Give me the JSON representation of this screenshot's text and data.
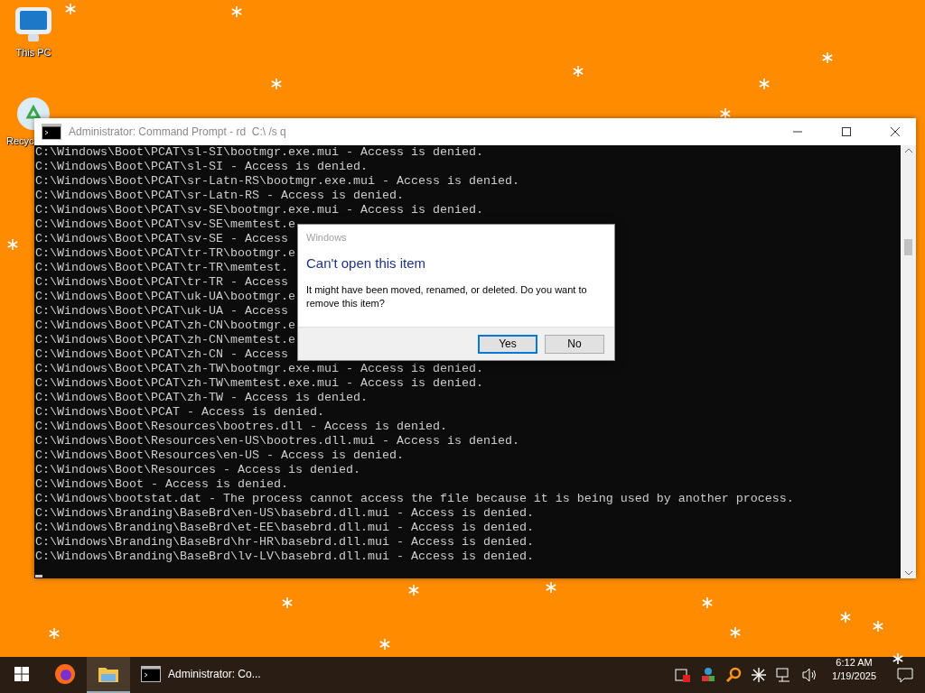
{
  "desktop": {
    "icons": [
      {
        "label": "This PC",
        "kind": "monitor"
      },
      {
        "label": "Recyc",
        "kind": "recycle"
      }
    ]
  },
  "console_window": {
    "title": "Administrator: Command Prompt - rd  C:\\ /s q",
    "lines": [
      "C:\\Windows\\Boot\\PCAT\\sl-SI\\bootmgr.exe.mui - Access is denied.",
      "C:\\Windows\\Boot\\PCAT\\sl-SI - Access is denied.",
      "C:\\Windows\\Boot\\PCAT\\sr-Latn-RS\\bootmgr.exe.mui - Access is denied.",
      "C:\\Windows\\Boot\\PCAT\\sr-Latn-RS - Access is denied.",
      "C:\\Windows\\Boot\\PCAT\\sv-SE\\bootmgr.exe.mui - Access is denied.",
      "C:\\Windows\\Boot\\PCAT\\sv-SE\\memtest.e",
      "C:\\Windows\\Boot\\PCAT\\sv-SE - Access",
      "C:\\Windows\\Boot\\PCAT\\tr-TR\\bootmgr.e",
      "C:\\Windows\\Boot\\PCAT\\tr-TR\\memtest.",
      "C:\\Windows\\Boot\\PCAT\\tr-TR - Access",
      "C:\\Windows\\Boot\\PCAT\\uk-UA\\bootmgr.e",
      "C:\\Windows\\Boot\\PCAT\\uk-UA - Access",
      "C:\\Windows\\Boot\\PCAT\\zh-CN\\bootmgr.e",
      "C:\\Windows\\Boot\\PCAT\\zh-CN\\memtest.e",
      "C:\\Windows\\Boot\\PCAT\\zh-CN - Access",
      "C:\\Windows\\Boot\\PCAT\\zh-TW\\bootmgr.exe.mui - Access is denied.",
      "C:\\Windows\\Boot\\PCAT\\zh-TW\\memtest.exe.mui - Access is denied.",
      "C:\\Windows\\Boot\\PCAT\\zh-TW - Access is denied.",
      "C:\\Windows\\Boot\\PCAT - Access is denied.",
      "C:\\Windows\\Boot\\Resources\\bootres.dll - Access is denied.",
      "C:\\Windows\\Boot\\Resources\\en-US\\bootres.dll.mui - Access is denied.",
      "C:\\Windows\\Boot\\Resources\\en-US - Access is denied.",
      "C:\\Windows\\Boot\\Resources - Access is denied.",
      "C:\\Windows\\Boot - Access is denied.",
      "C:\\Windows\\bootstat.dat - The process cannot access the file because it is being used by another process.",
      "C:\\Windows\\Branding\\BaseBrd\\en-US\\basebrd.dll.mui - Access is denied.",
      "C:\\Windows\\Branding\\BaseBrd\\et-EE\\basebrd.dll.mui - Access is denied.",
      "C:\\Windows\\Branding\\BaseBrd\\hr-HR\\basebrd.dll.mui - Access is denied.",
      "C:\\Windows\\Branding\\BaseBrd\\lv-LV\\basebrd.dll.mui - Access is denied."
    ]
  },
  "dialog": {
    "title": "Windows",
    "heading": "Can't open this item",
    "message": "It might have been moved, renamed, or deleted. Do you want to remove this item?",
    "buttons": [
      {
        "label": "Yes",
        "selected": true
      },
      {
        "label": "No",
        "selected": false
      }
    ]
  },
  "taskbar": {
    "items": [
      {
        "kind": "start",
        "active": false
      },
      {
        "kind": "browser",
        "active": false
      },
      {
        "kind": "folder",
        "active": true
      },
      {
        "kind": "console",
        "label": "Administrator: Co...",
        "active": false
      }
    ],
    "tray": [
      {
        "kind": "alert"
      },
      {
        "kind": "network-people"
      },
      {
        "kind": "search"
      },
      {
        "kind": "asterisk"
      },
      {
        "kind": "network"
      },
      {
        "kind": "volume"
      }
    ],
    "clock": {
      "time": "6:12 AM",
      "date": "1/19/2025"
    }
  }
}
